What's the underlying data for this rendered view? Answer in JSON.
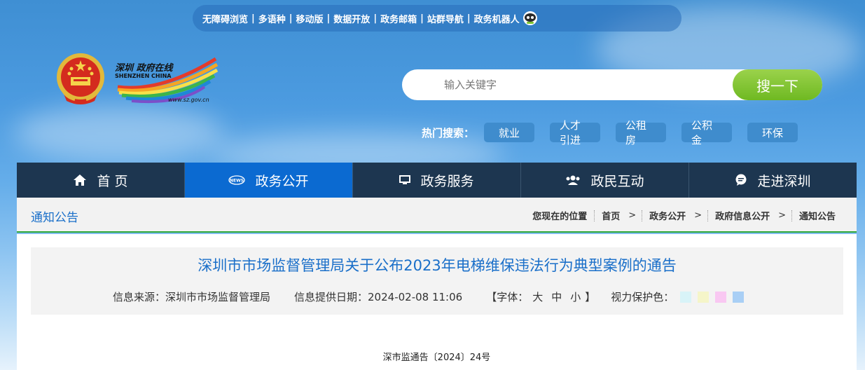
{
  "top_links": [
    "无障碍浏览",
    "多语种",
    "移动版",
    "数据开放",
    "政务邮箱",
    "站群导航",
    "政务机器人"
  ],
  "logo": {
    "text_cn": "深圳 政府在线",
    "text_en": "SHENZHEN CHINA",
    "url": "www.sz.gov.cn"
  },
  "search": {
    "placeholder": "输入关键字",
    "button": "搜一下"
  },
  "hot_search": {
    "label": "热门搜索：",
    "tags": [
      "就业",
      "人才引进",
      "公租房",
      "公积金",
      "环保"
    ]
  },
  "nav": [
    {
      "label": "首 页",
      "icon": "home-icon"
    },
    {
      "label": "政务公开",
      "icon": "news-icon",
      "active": true
    },
    {
      "label": "政务服务",
      "icon": "monitor-icon"
    },
    {
      "label": "政民互动",
      "icon": "people-icon"
    },
    {
      "label": "走进深圳",
      "icon": "chat-icon"
    }
  ],
  "section_title": "通知公告",
  "breadcrumb": {
    "label": "您现在的位置",
    "items": [
      "首页",
      "政务公开",
      "政府信息公开",
      "通知公告"
    ]
  },
  "article": {
    "title": "深圳市市场监督管理局关于公布2023年电梯维保违法行为典型案例的通告",
    "source": "信息来源：深圳市市场监督管理局",
    "date": "信息提供日期：2024-02-08 11:06",
    "font_label": "【字体：",
    "font_sizes": [
      "大",
      "中",
      "小"
    ],
    "font_close": "】",
    "eye_care_label": "视力保护色：",
    "eye_care_colors": [
      "#d8f3f8",
      "#f5f5c9",
      "#f9c8f2",
      "#a9cff5"
    ],
    "doc_number": "深市监通告〔2024〕24号"
  },
  "colors": {
    "nav_bg": "#1d3650",
    "nav_active": "#0b6ad1",
    "accent_blue": "#1a6fc9",
    "search_button": "#7cc22e",
    "divider_green": "#2fa83a"
  }
}
